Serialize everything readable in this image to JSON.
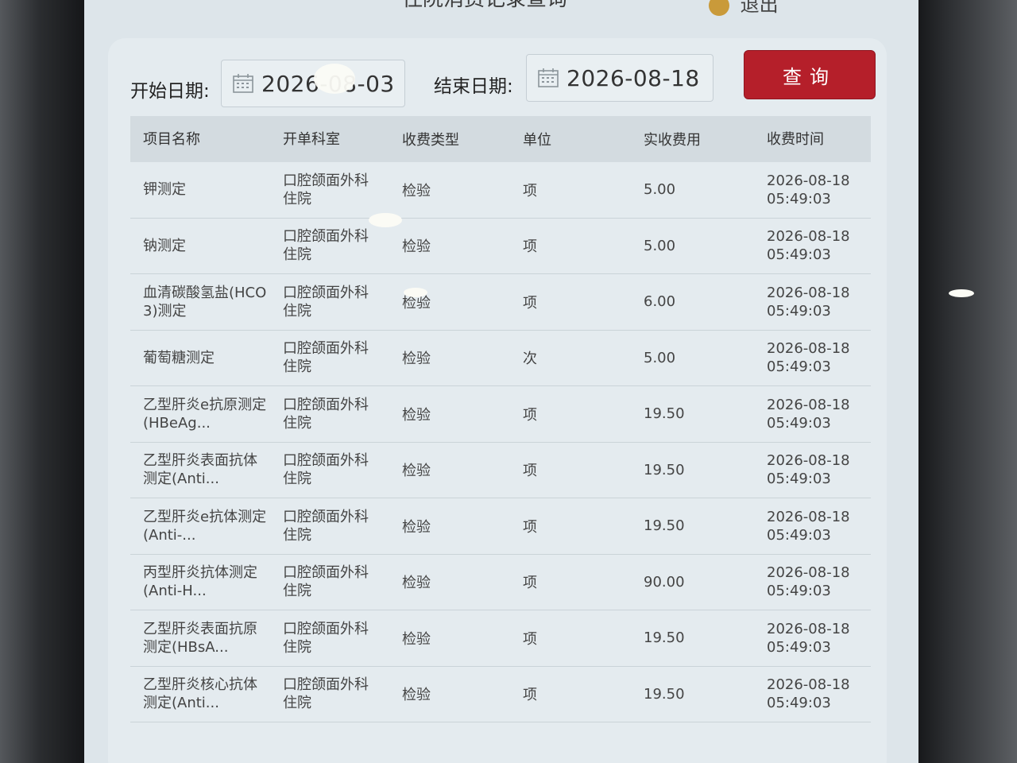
{
  "header": {
    "title": "住院消费记录查询",
    "user": "退出"
  },
  "filters": {
    "start_label": "开始日期:",
    "start_value": "2026-08-03",
    "end_label": "结束日期:",
    "end_value": "2026-08-18",
    "query_button": "查询"
  },
  "table": {
    "columns": [
      "项目名称",
      "开单科室",
      "收费类型",
      "单位",
      "实收费用",
      "收费时间"
    ],
    "rows": [
      {
        "name": [
          "钾测定"
        ],
        "dept": [
          "口腔颌面外科",
          "住院"
        ],
        "type": "检验",
        "unit": "项",
        "fee": "5.00",
        "time": [
          "2026-08-18",
          "05:49:03"
        ]
      },
      {
        "name": [
          "钠测定"
        ],
        "dept": [
          "口腔颌面外科",
          "住院"
        ],
        "type": "检验",
        "unit": "项",
        "fee": "5.00",
        "time": [
          "2026-08-18",
          "05:49:03"
        ]
      },
      {
        "name": [
          "血清碳酸氢盐(HCO",
          "3)测定"
        ],
        "dept": [
          "口腔颌面外科",
          "住院"
        ],
        "type": "检验",
        "unit": "项",
        "fee": "6.00",
        "time": [
          "2026-08-18",
          "05:49:03"
        ]
      },
      {
        "name": [
          "葡萄糖测定"
        ],
        "dept": [
          "口腔颌面外科",
          "住院"
        ],
        "type": "检验",
        "unit": "次",
        "fee": "5.00",
        "time": [
          "2026-08-18",
          "05:49:03"
        ]
      },
      {
        "name": [
          "乙型肝炎e抗原测定",
          "(HBeAg..."
        ],
        "dept": [
          "口腔颌面外科",
          "住院"
        ],
        "type": "检验",
        "unit": "项",
        "fee": "19.50",
        "time": [
          "2026-08-18",
          "05:49:03"
        ]
      },
      {
        "name": [
          "乙型肝炎表面抗体",
          "测定(Anti..."
        ],
        "dept": [
          "口腔颌面外科",
          "住院"
        ],
        "type": "检验",
        "unit": "项",
        "fee": "19.50",
        "time": [
          "2026-08-18",
          "05:49:03"
        ]
      },
      {
        "name": [
          "乙型肝炎e抗体测定",
          "(Anti-..."
        ],
        "dept": [
          "口腔颌面外科",
          "住院"
        ],
        "type": "检验",
        "unit": "项",
        "fee": "19.50",
        "time": [
          "2026-08-18",
          "05:49:03"
        ]
      },
      {
        "name": [
          "丙型肝炎抗体测定",
          "(Anti-H..."
        ],
        "dept": [
          "口腔颌面外科",
          "住院"
        ],
        "type": "检验",
        "unit": "项",
        "fee": "90.00",
        "time": [
          "2026-08-18",
          "05:49:03"
        ]
      },
      {
        "name": [
          "乙型肝炎表面抗原",
          "测定(HBsA..."
        ],
        "dept": [
          "口腔颌面外科",
          "住院"
        ],
        "type": "检验",
        "unit": "项",
        "fee": "19.50",
        "time": [
          "2026-08-18",
          "05:49:03"
        ]
      },
      {
        "name": [
          "乙型肝炎核心抗体",
          "测定(Anti..."
        ],
        "dept": [
          "口腔颌面外科",
          "住院"
        ],
        "type": "检验",
        "unit": "项",
        "fee": "19.50",
        "time": [
          "2026-08-18",
          "05:49:03"
        ]
      }
    ]
  },
  "colors": {
    "accent": "#b51f2a",
    "screen_bg": "#dde5ea",
    "header_bg": "#d3dbe0"
  },
  "icons": {
    "date": "calendar-icon",
    "user": "coin-icon"
  }
}
